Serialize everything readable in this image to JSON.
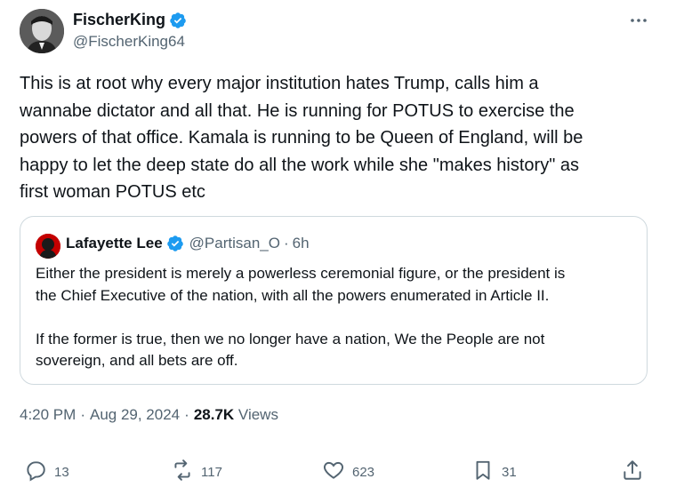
{
  "author": {
    "display_name": "FischerKing",
    "handle": "@FischerKing64"
  },
  "tweet": {
    "text": "This is at root why every major institution hates Trump, calls him a\nwannabe dictator and all that. He is running for POTUS to exercise the\npowers of that office. Kamala is running to be Queen of England, will be\nhappy to let the deep state do all the work while she \"makes history\" as\nfirst woman POTUS etc"
  },
  "quote": {
    "display_name": "Lafayette Lee",
    "handle": "@Partisan_O",
    "separator": "·",
    "time": "6h",
    "text": "Either the president is merely a powerless ceremonial figure, or the president is\nthe Chief Executive of the nation, with all the powers enumerated in Article II.\n\nIf the former is true, then we no longer have a nation, We the People are not\nsovereign, and all bets are off."
  },
  "meta": {
    "time": "4:20 PM",
    "dot1": "·",
    "date": "Aug 29, 2024",
    "dot2": "·",
    "views_count": "28.7K",
    "views_label": "Views"
  },
  "actions": {
    "replies": "13",
    "reposts": "117",
    "likes": "623",
    "bookmarks": "31"
  },
  "colors": {
    "verified": "#1d9bf0",
    "secondary_text": "#536471",
    "border": "#cfd9de"
  }
}
